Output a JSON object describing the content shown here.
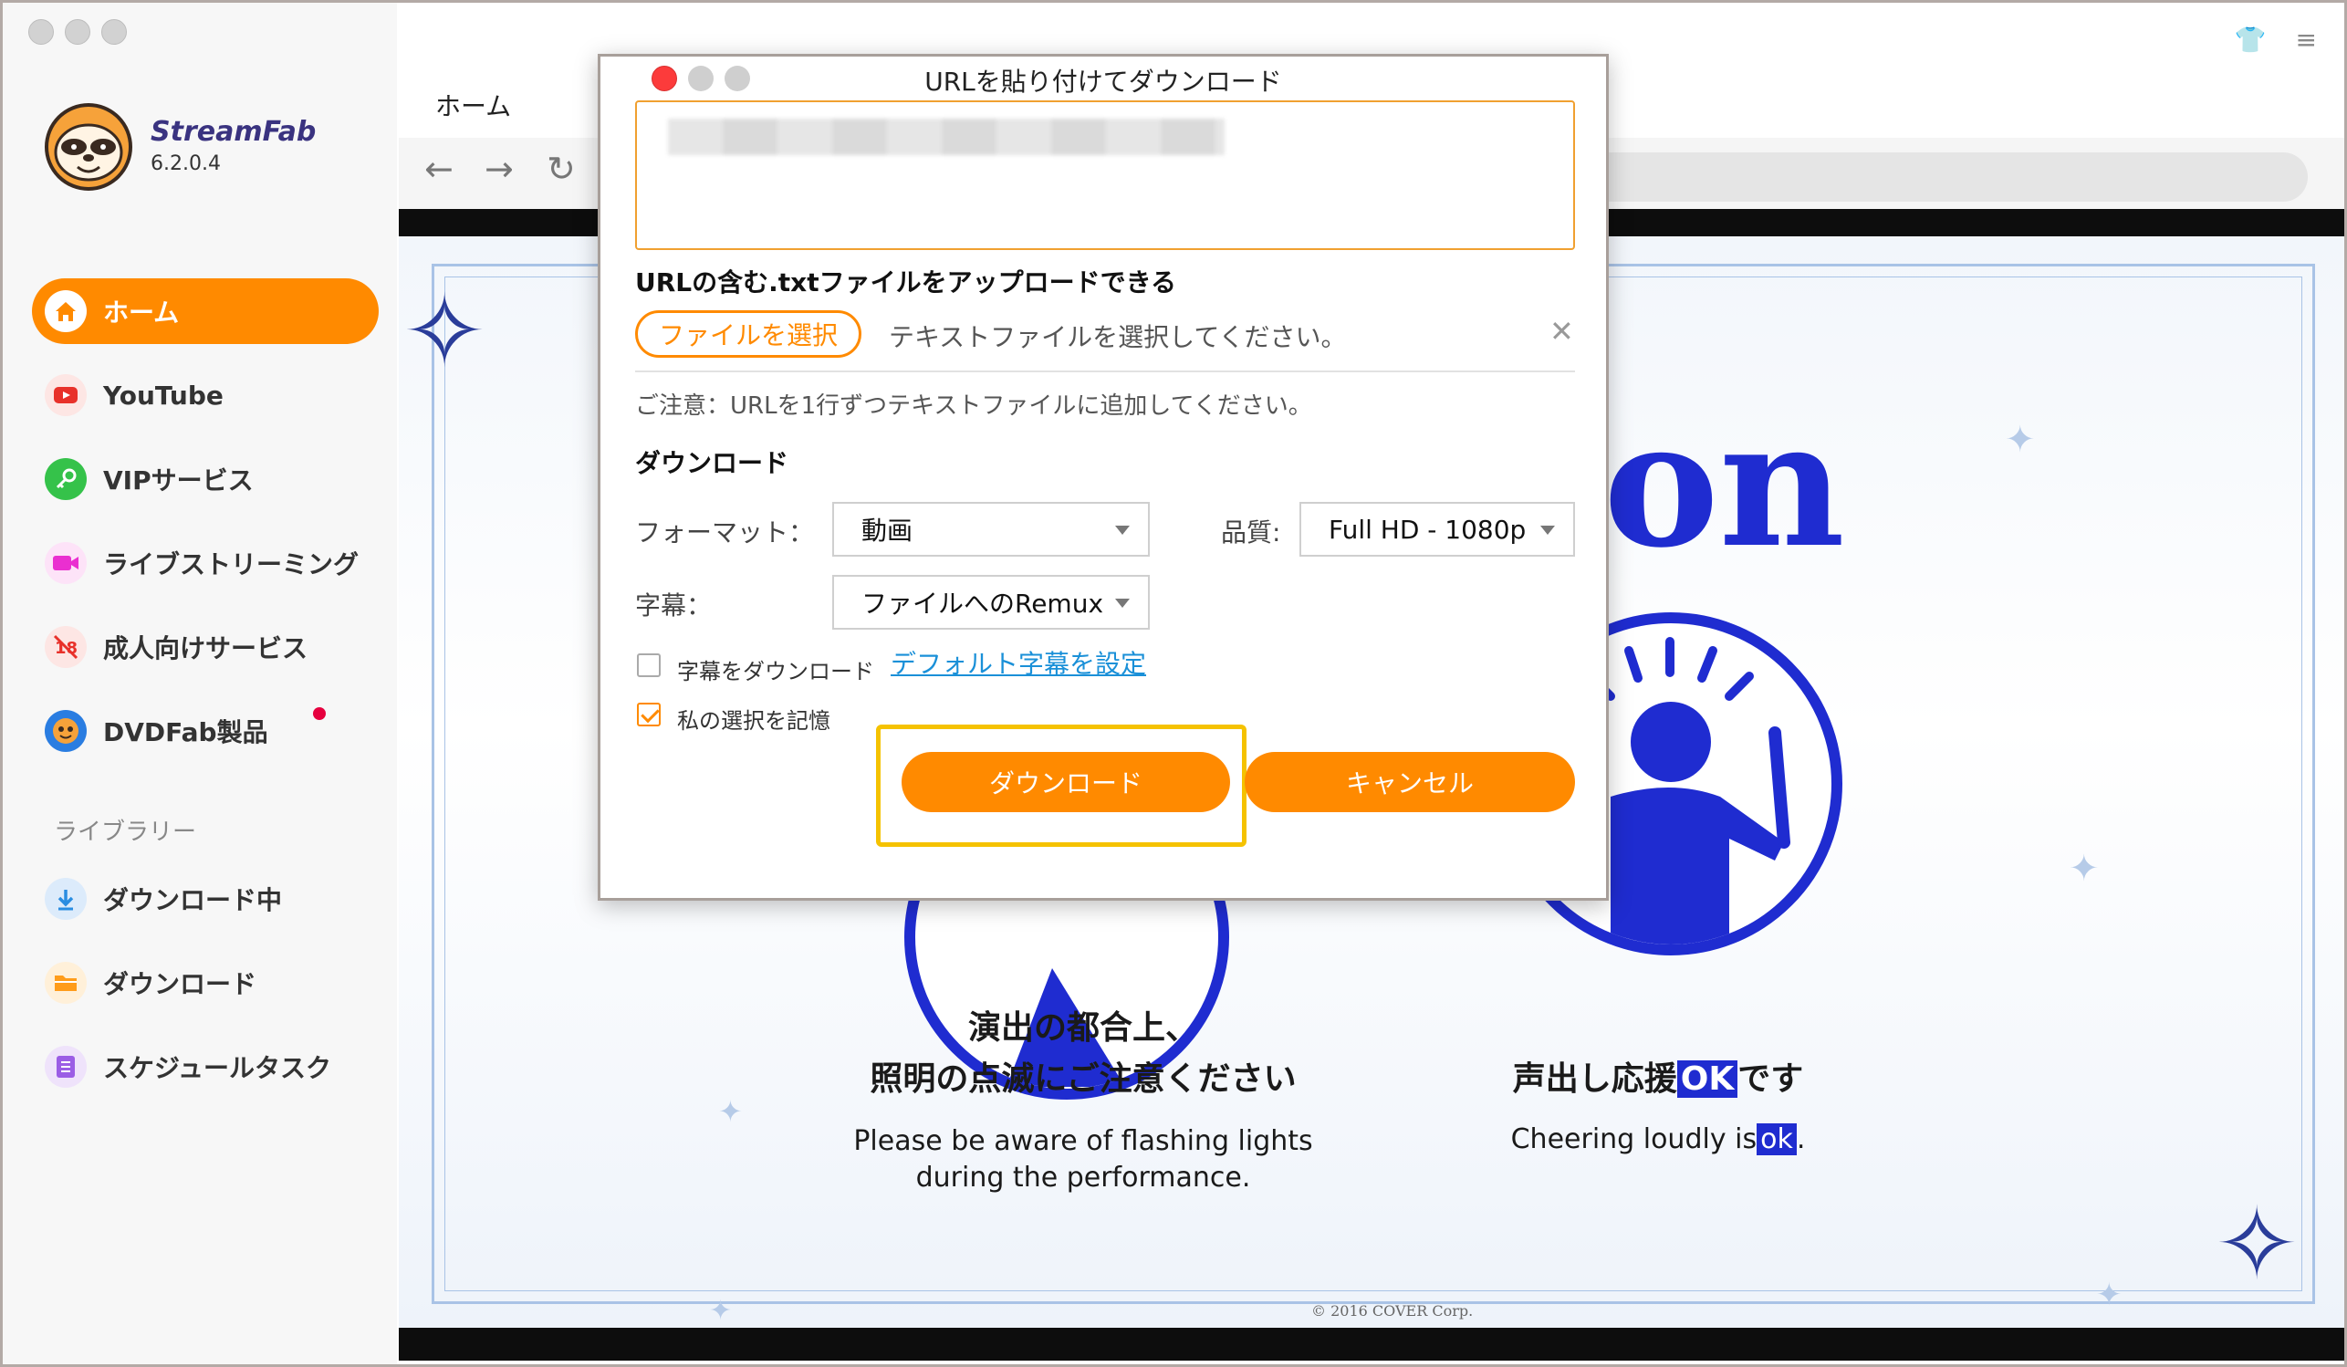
{
  "app": {
    "brand": "StreamFab",
    "version": "6.2.0.4"
  },
  "sidebar": {
    "items": [
      {
        "label": "ホーム",
        "icon": "home-icon",
        "color": "#ff8a00"
      },
      {
        "label": "YouTube",
        "icon": "youtube-icon",
        "color": "#e8312a"
      },
      {
        "label": "VIPサービス",
        "icon": "key-icon",
        "color": "#35c24a"
      },
      {
        "label": "ライブストリーミング",
        "icon": "live-camera-icon",
        "color": "#ea2fd0"
      },
      {
        "label": "成人向けサービス",
        "icon": "adult-18-icon",
        "color": "#e8312a"
      },
      {
        "label": "DVDFab製品",
        "icon": "dvdfab-logo-icon",
        "color": "#2a7de1"
      }
    ],
    "library_label": "ライブラリー",
    "library_items": [
      {
        "label": "ダウンロード中",
        "icon": "download-arrow-icon",
        "color": "#2a8de1"
      },
      {
        "label": "ダウンロード",
        "icon": "folder-icon",
        "color": "#ff9c1a"
      },
      {
        "label": "スケジュールタスク",
        "icon": "schedule-list-icon",
        "color": "#9b5de5"
      }
    ]
  },
  "topbar": {
    "home_tab": "ホーム"
  },
  "webpage": {
    "hero_text": "on",
    "caption_left_jp_1": "演出の都合上、",
    "caption_left_jp_2": "照明の点滅にご注意ください",
    "caption_left_en_1": "Please be aware of flashing lights",
    "caption_left_en_2": "during the performance.",
    "caption_right_jp_prefix": "声出し応援",
    "caption_right_jp_hl": "OK",
    "caption_right_jp_suffix": "です",
    "caption_right_en_prefix": "Cheering loudly is",
    "caption_right_en_hl": "ok",
    "caption_right_en_suffix": ".",
    "copyright": "© 2016 COVER Corp."
  },
  "dialog": {
    "title": "URLを貼り付けてダウンロード",
    "upload_label": "URLの含む.txtファイルをアップロードできる",
    "file_button": "ファイルを選択",
    "file_hint": "テキストファイルを選択してください。",
    "note": "ご注意：URLを1行ずつテキストファイルに追加してください。",
    "download_section": "ダウンロード",
    "format_label": "フォーマット：",
    "format_value": "動画",
    "quality_label": "品質:",
    "quality_value": "Full HD - 1080p",
    "subtitle_label": "字幕：",
    "subtitle_value": "ファイルへのRemux",
    "download_subtitle_label": "字幕をダウンロード",
    "download_subtitle_checked": false,
    "default_subtitle_link": "デフォルト字幕を設定",
    "remember_label": "私の選択を記憶",
    "remember_checked": true,
    "download_button": "ダウンロード",
    "cancel_button": "キャンセル"
  }
}
